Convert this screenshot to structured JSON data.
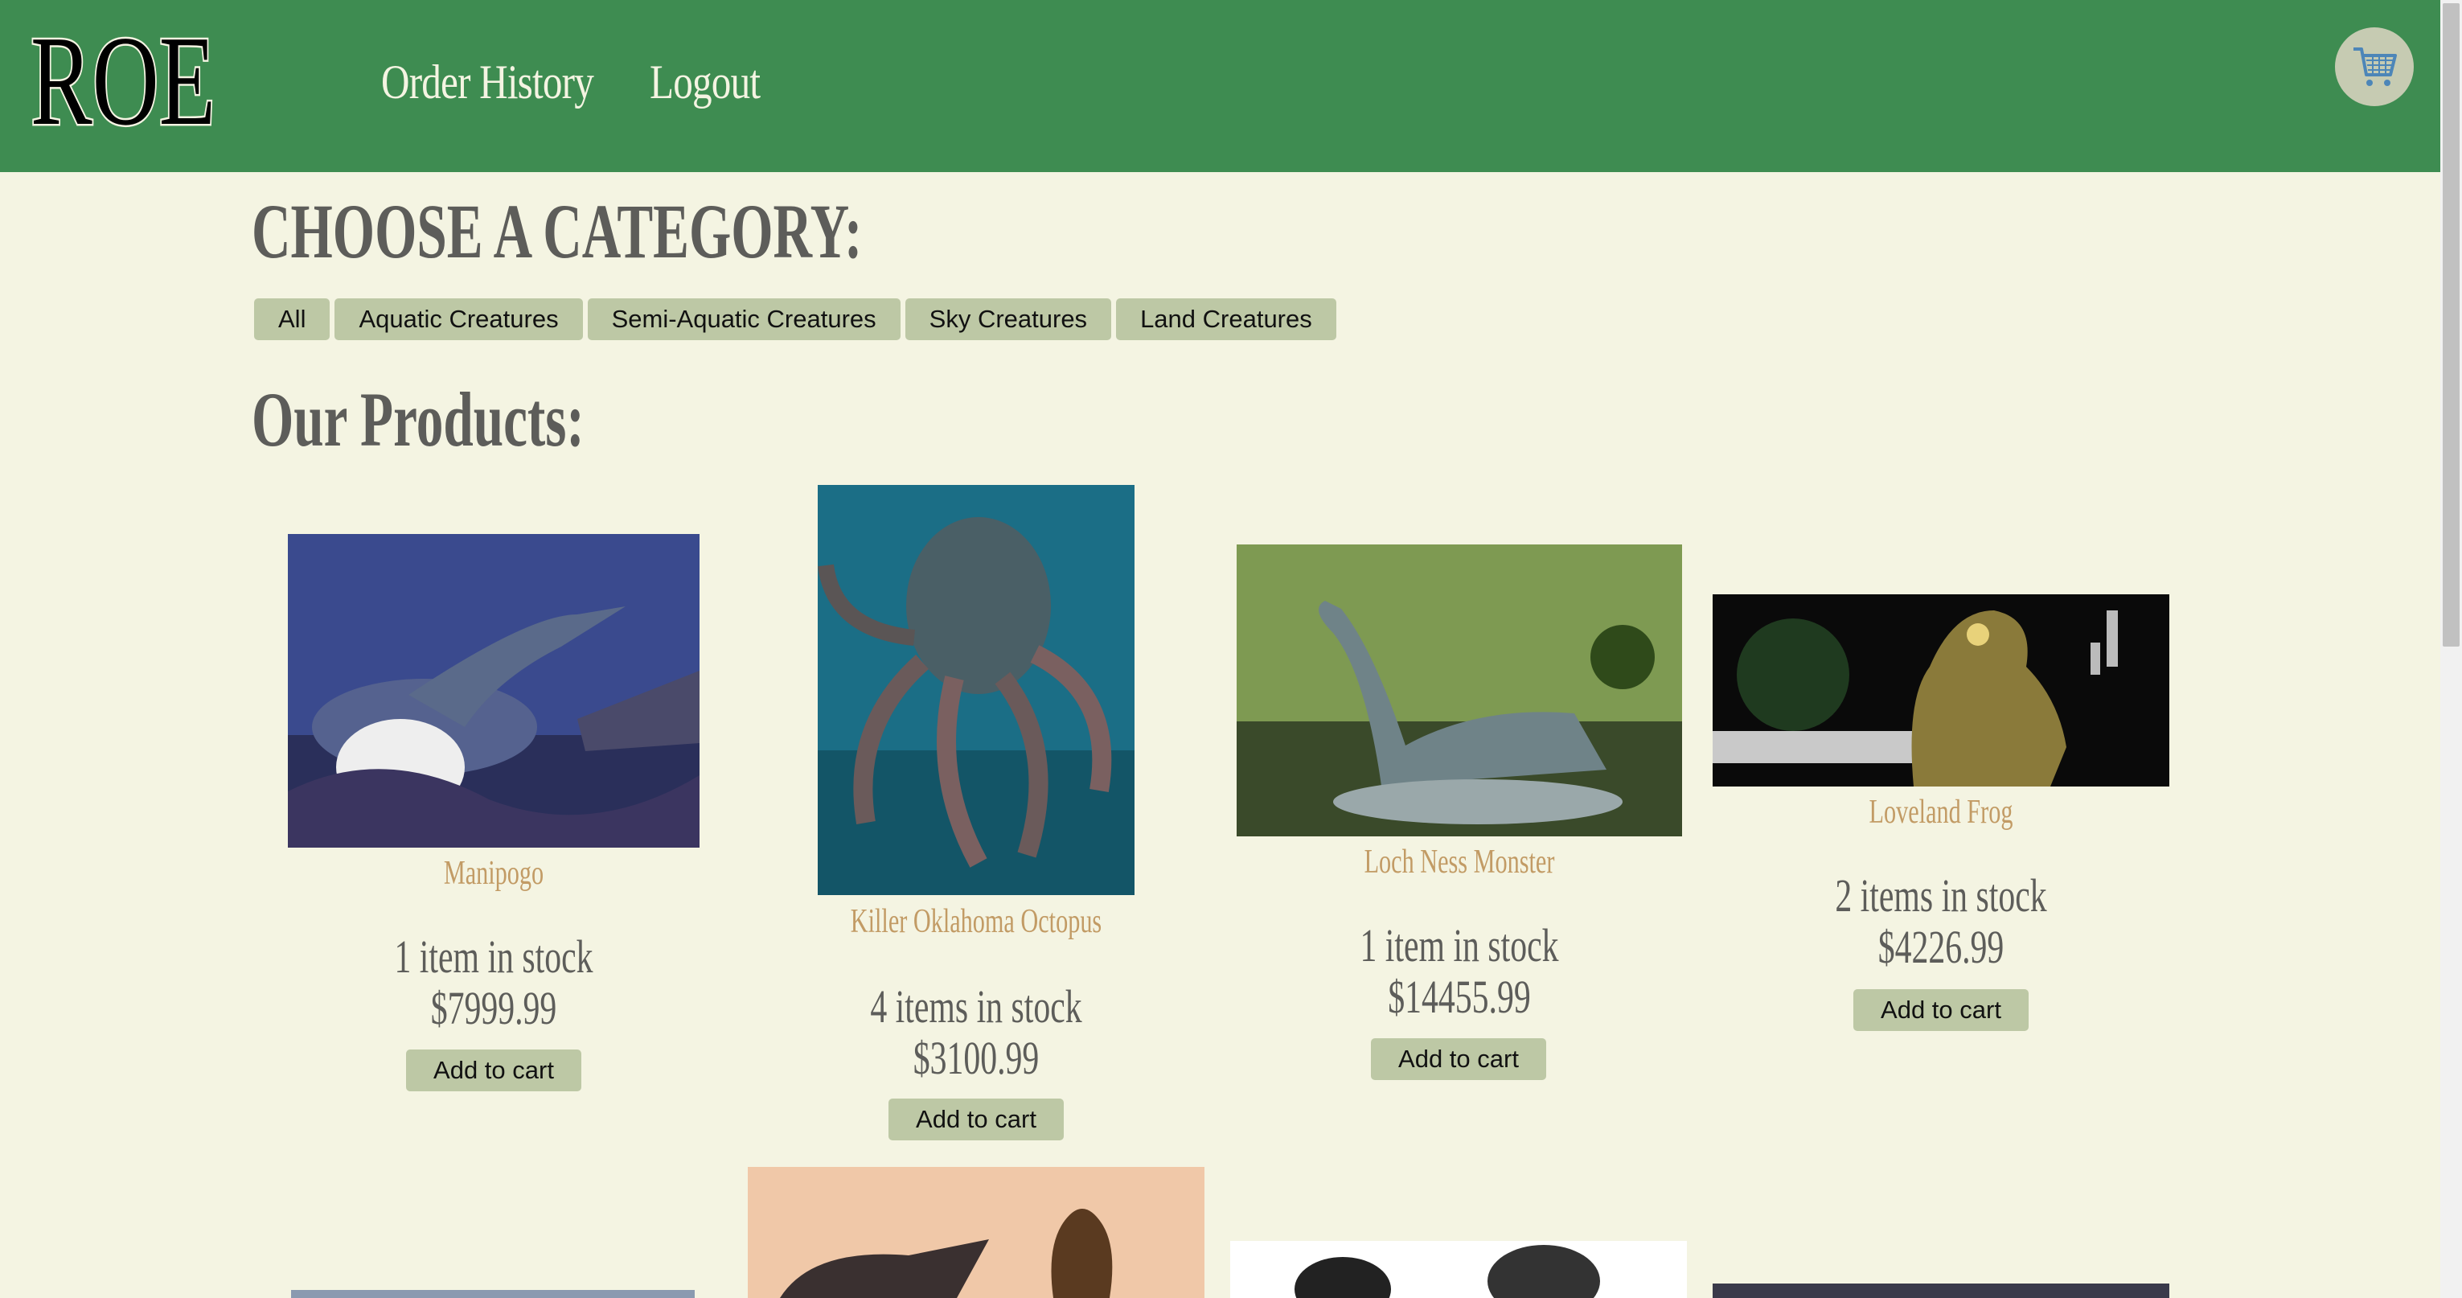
{
  "header": {
    "logo_text": "ROE",
    "nav": {
      "order_history": "Order History",
      "logout": "Logout"
    }
  },
  "categories": {
    "heading": "CHOOSE A CATEGORY:",
    "items": [
      "All",
      "Aquatic Creatures",
      "Semi-Aquatic Creatures",
      "Sky Creatures",
      "Land Creatures"
    ]
  },
  "products": {
    "heading": "Our Products:",
    "add_label": "Add to cart",
    "items": [
      {
        "name": "Manipogo",
        "stock": "1 item in stock",
        "price": "$7999.99"
      },
      {
        "name": "Killer Oklahoma Octopus",
        "stock": "4 items in stock",
        "price": "$3100.99"
      },
      {
        "name": "Loch Ness Monster",
        "stock": "1 item in stock",
        "price": "$14455.99"
      },
      {
        "name": "Loveland Frog",
        "stock": "2 items in stock",
        "price": "$4226.99"
      }
    ]
  },
  "colors": {
    "header_bg": "#3e8c51",
    "page_bg": "#f4f4e2",
    "button_bg": "#bdc8a5",
    "product_name": "#c29b65",
    "text_dark": "#5d5d5a"
  },
  "icons": {
    "cart": "shopping-cart-icon"
  }
}
